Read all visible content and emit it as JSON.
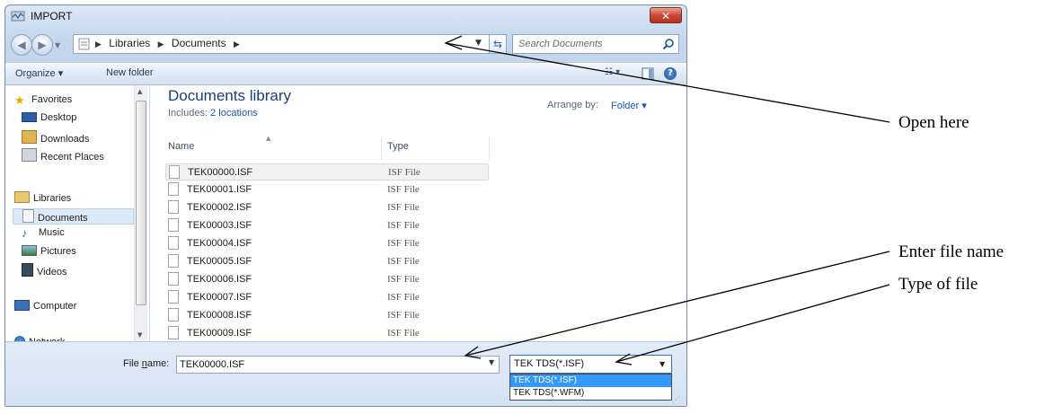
{
  "window": {
    "title": "IMPORT",
    "close_glyph": "✕"
  },
  "nav": {
    "back_glyph": "◀",
    "forward_glyph": "▶",
    "breadcrumb": [
      "Libraries",
      "Documents"
    ],
    "search_placeholder": "Search Documents"
  },
  "toolbar": {
    "organize_label": "Organize ▾",
    "new_folder_label": "New folder",
    "views_glyph": "☷ ▾",
    "help_glyph": "?"
  },
  "sidebar": {
    "favorites": "Favorites",
    "desktop": "Desktop",
    "downloads": "Downloads",
    "recent_places": "Recent Places",
    "libraries": "Libraries",
    "documents": "Documents",
    "music": "Music",
    "pictures": "Pictures",
    "videos": "Videos",
    "computer": "Computer",
    "network": "Network"
  },
  "library": {
    "title": "Documents library",
    "includes_prefix": "Includes:",
    "includes_link": "2 locations",
    "arrange_label": "Arrange by:",
    "arrange_value": "Folder ▾"
  },
  "columns": {
    "name": "Name",
    "type": "Type"
  },
  "files": [
    {
      "name": "TEK00000.ISF",
      "type": "ISF File"
    },
    {
      "name": "TEK00001.ISF",
      "type": "ISF File"
    },
    {
      "name": "TEK00002.ISF",
      "type": "ISF File"
    },
    {
      "name": "TEK00003.ISF",
      "type": "ISF File"
    },
    {
      "name": "TEK00004.ISF",
      "type": "ISF File"
    },
    {
      "name": "TEK00005.ISF",
      "type": "ISF File"
    },
    {
      "name": "TEK00006.ISF",
      "type": "ISF File"
    },
    {
      "name": "TEK00007.ISF",
      "type": "ISF File"
    },
    {
      "name": "TEK00008.ISF",
      "type": "ISF File"
    },
    {
      "name": "TEK00009.ISF",
      "type": "ISF File"
    }
  ],
  "bottom": {
    "filename_label_prefix": "File ",
    "filename_label_underlined": "n",
    "filename_label_suffix": "ame:",
    "filename_value": "TEK00000.ISF",
    "filetype_value": "TEK TDS(*.ISF)",
    "filetype_options": [
      "TEK TDS(*.ISF)",
      "TEK TDS(*.WFM)"
    ]
  },
  "annotations": {
    "open_here": "Open here",
    "enter_file_name": "Enter file name",
    "type_of_file": "Type of file"
  }
}
